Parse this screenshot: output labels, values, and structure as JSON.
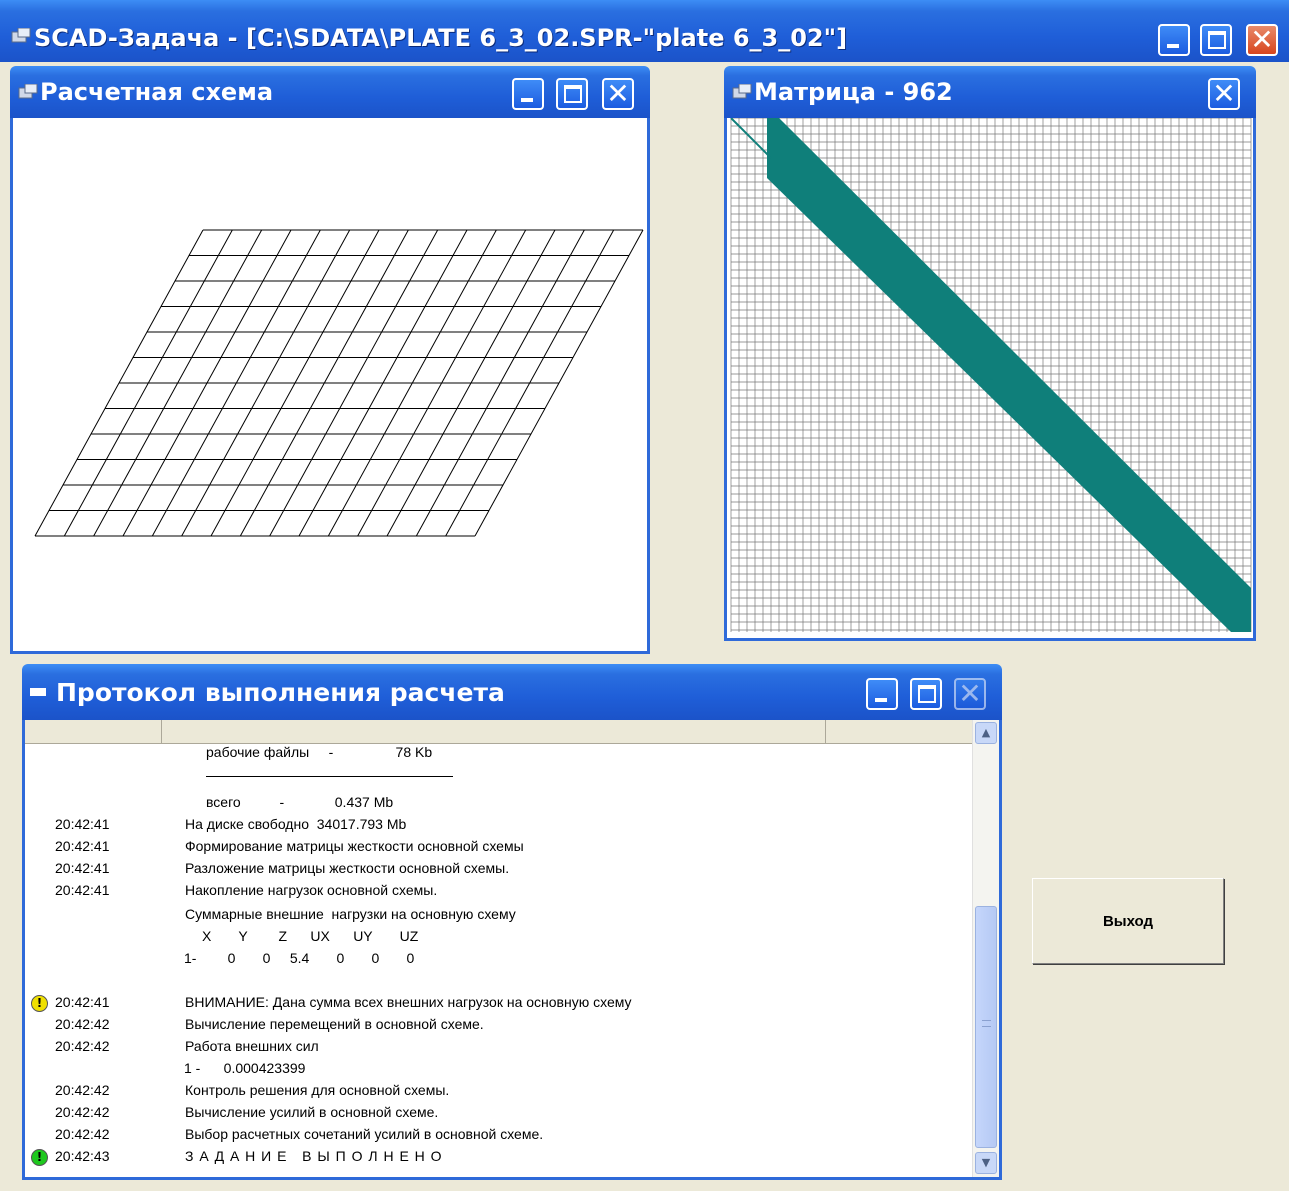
{
  "main_window": {
    "title": "SCAD-Задача - [C:\\SDATA\\PLATE 6_3_02.SPR-\"plate 6_3_02\"]"
  },
  "scheme_window": {
    "title": "Расчетная схема"
  },
  "matrix_window": {
    "title": "Матрица - 962"
  },
  "protocol_window": {
    "title": "Протокол выполнения расчета"
  },
  "colors": {
    "titlebar": "#1f5ed8",
    "desktop": "#ece9d8",
    "matrix_fill": "#0f7f7a",
    "warning": "#f0e000",
    "ok": "#1ec81e"
  },
  "protocol": {
    "lines": [
      {
        "time": "",
        "text": "рабочие файлы     -                78 Kb"
      },
      {
        "time": "",
        "text": "всего          -             0.437 Mb"
      },
      {
        "time": "20:42:41",
        "text": "На диске свободно  34017.793 Mb"
      },
      {
        "time": "20:42:41",
        "text": "Формирование матрицы жесткости основной схемы"
      },
      {
        "time": "20:42:41",
        "text": "Разложение матрицы жесткости основной схемы."
      },
      {
        "time": "20:42:41",
        "text": "Накопление нагрузок основной схемы."
      },
      {
        "time": "",
        "text": "Суммарные внешние  нагрузки на основную схему"
      },
      {
        "time": "",
        "text": "X       Y        Z      UX      UY       UZ"
      },
      {
        "time": "",
        "text": "1-        0       0     5.4       0       0       0"
      },
      {
        "time": "20:42:41",
        "text": "ВНИМАНИЕ: Дана сумма всех внешних нагрузок на основную схему"
      },
      {
        "time": "20:42:42",
        "text": "Вычисление перемещений в основной схеме."
      },
      {
        "time": "20:42:42",
        "text": "Работа внешних сил"
      },
      {
        "time": "",
        "text": "1 -      0.000423399"
      },
      {
        "time": "20:42:42",
        "text": "Контроль решения для основной схемы."
      },
      {
        "time": "20:42:42",
        "text": "Вычисление усилий в основной схеме."
      },
      {
        "time": "20:42:42",
        "text": "Выбор расчетных сочетаний усилий в основной схеме."
      },
      {
        "time": "20:42:43",
        "text": "З А Д А Н И Е   В Ы П О Л Н Е Н О"
      }
    ],
    "warning_icon_glyph": "!",
    "ok_icon_glyph": "!"
  },
  "exit_button": {
    "label": "Выход"
  }
}
